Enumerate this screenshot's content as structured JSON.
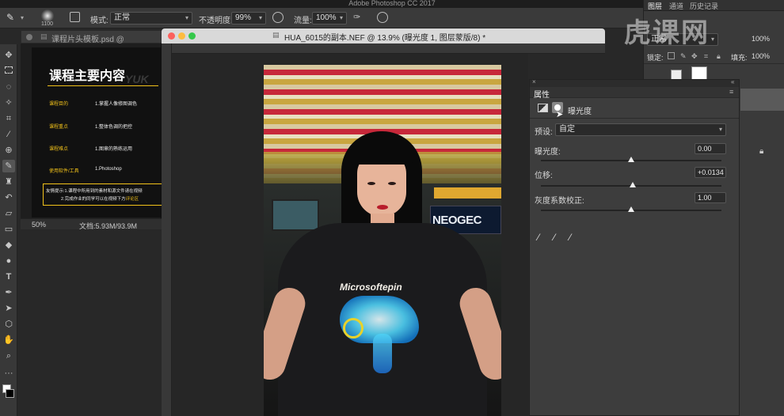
{
  "app": {
    "title": "Adobe Photoshop CC 2017"
  },
  "options": {
    "brush_size": "1100",
    "mode_label": "模式:",
    "mode_value": "正常",
    "opacity_label": "不透明度:",
    "opacity_value": "99%",
    "flow_label": "流量:",
    "flow_value": "100%"
  },
  "doc1": {
    "tab_title": "课程片头模板.psd @",
    "heading": "课程主要内容",
    "heading_deco": "YUK",
    "rows": [
      {
        "label": "课程目的",
        "value": "1.掌握人像修图调色"
      },
      {
        "label": "课程重点",
        "value": "1.整体色调的把控"
      },
      {
        "label": "课程难点",
        "value": "1.图章的熟练运用"
      },
      {
        "label": "使用软件/工具",
        "value": "1.Photoshop"
      }
    ],
    "tip_line1": "友情提示:1.课程中所用到的素材和源文件请在视频",
    "tip_line2_prefix": "2.完成作业的同学可以在视频下方",
    "tip_line2_highlight": "评论区",
    "zoom": "50%",
    "doc_info": "文档:5.93M/93.9M"
  },
  "doc2": {
    "tab_title": "HUA_6015的副本.NEF @ 13.9% (曝光度 1, 图层蒙版/8) *"
  },
  "photo": {
    "shirt_text": "Microsoftepin",
    "sign_text": "NEOGEC"
  },
  "layers": {
    "tabs": [
      "图层",
      "通道",
      "历史记录"
    ],
    "lock_label": "锁定:",
    "fill_label": "填充:",
    "fill_value": "100%",
    "opacity_value": "100%",
    "blend_value": "正常"
  },
  "props": {
    "title": "属性",
    "panel_name": "曝光度",
    "preset_label": "预设:",
    "preset_value": "自定",
    "exposure_label": "曝光度:",
    "exposure_value": "0.00",
    "exposure_pos": 0.5,
    "offset_label": "位移:",
    "offset_value": "+0.0134",
    "offset_pos": 0.51,
    "gamma_label": "灰度系数校正:",
    "gamma_value": "1.00",
    "gamma_pos": 0.5
  },
  "watermark": "虎课网",
  "colors": {
    "accent_yellow": "#f2c21a",
    "panel_bg": "#3d3d3d"
  }
}
